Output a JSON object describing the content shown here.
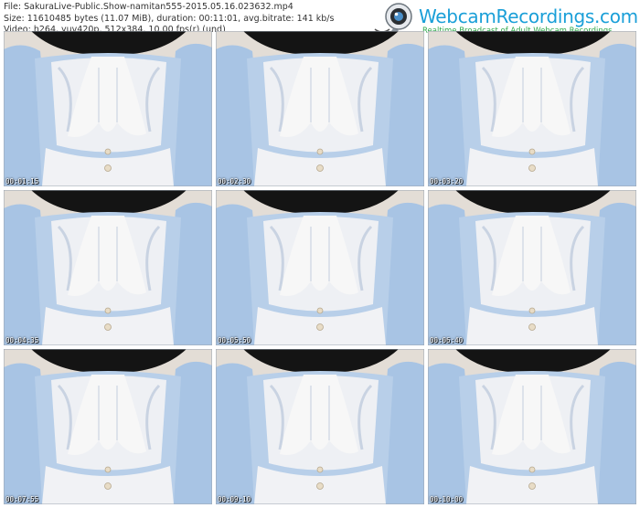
{
  "header": {
    "file_line": "File: SakuraLive-Public.Show-namitan555-2015.05.16.023632.mp4",
    "size_line": "Size: 11610485 bytes (11.07 MiB), duration: 00:11:01, avg.bitrate: 141 kb/s",
    "video_line": "Video: h264, yuv420p, 512x384, 10.00 fps(r) (und)"
  },
  "logo": {
    "brand": "WebcamRecordings.com",
    "tagline": "Realtime Broadcast of Adult Webcam Recordings",
    "icon": "webcam-icon"
  },
  "thumbnails": [
    {
      "timestamp": "00:01:15"
    },
    {
      "timestamp": "00:02:30"
    },
    {
      "timestamp": "00:03:20"
    },
    {
      "timestamp": "00:04:35"
    },
    {
      "timestamp": "00:05:50"
    },
    {
      "timestamp": "00:06:40"
    },
    {
      "timestamp": "00:07:55"
    },
    {
      "timestamp": "00:09:10"
    },
    {
      "timestamp": "00:10:00"
    }
  ],
  "colors": {
    "brand": "#1a9fd8",
    "tagline": "#2fa84a",
    "dress": "#a8c4e4",
    "ruffle": "#eef0f4",
    "hair": "#141414"
  }
}
